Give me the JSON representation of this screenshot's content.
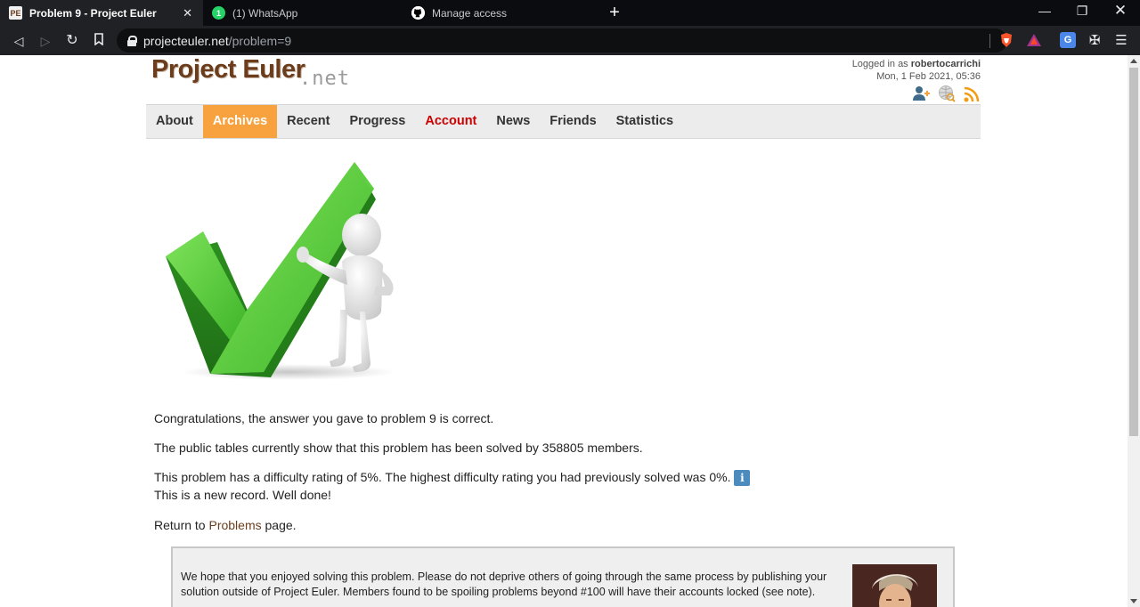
{
  "browser": {
    "tabs": [
      {
        "title": "Problem 9 - Project Euler",
        "icon": "project-euler-favicon",
        "active": true
      },
      {
        "title": "(1) WhatsApp",
        "icon": "whatsapp-icon",
        "badge": "1",
        "active": false
      },
      {
        "title": "Manage access",
        "icon": "github-icon",
        "active": false
      }
    ],
    "close_tab": "✕",
    "new_tab": "+",
    "url_host": "projecteuler.net",
    "url_path": "/problem=9"
  },
  "site": {
    "logo_main": "Project Euler",
    "logo_suffix": ".net",
    "logged_in_prefix": "Logged in as ",
    "username": "robertocarrichi",
    "datetime": "Mon, 1 Feb 2021, 05:36",
    "nav": [
      "About",
      "Archives",
      "Recent",
      "Progress",
      "Account",
      "News",
      "Friends",
      "Statistics"
    ],
    "nav_active": "Archives"
  },
  "result": {
    "congrats": "Congratulations, the answer you gave to problem 9 is correct.",
    "solved_by": "The public tables currently show that this problem has been solved by 358805 members.",
    "difficulty": "This problem has a difficulty rating of 5%. The highest difficulty rating you had previously solved was 0%.",
    "info_badge": "i",
    "record": "This is a new record. Well done!",
    "return_prefix": "Return to ",
    "return_link": "Problems",
    "return_suffix": " page.",
    "notice": "We hope that you enjoyed solving this problem. Please do not deprive others of going through the same process by publishing your solution outside of Project Euler. Members found to be spoiling problems beyond #100 will have their accounts locked (see note)."
  },
  "colors": {
    "brand_brown": "#6b3d1d",
    "nav_active": "#f7a23e",
    "account_red": "#cc0000",
    "check_green": "#4cc23a"
  }
}
